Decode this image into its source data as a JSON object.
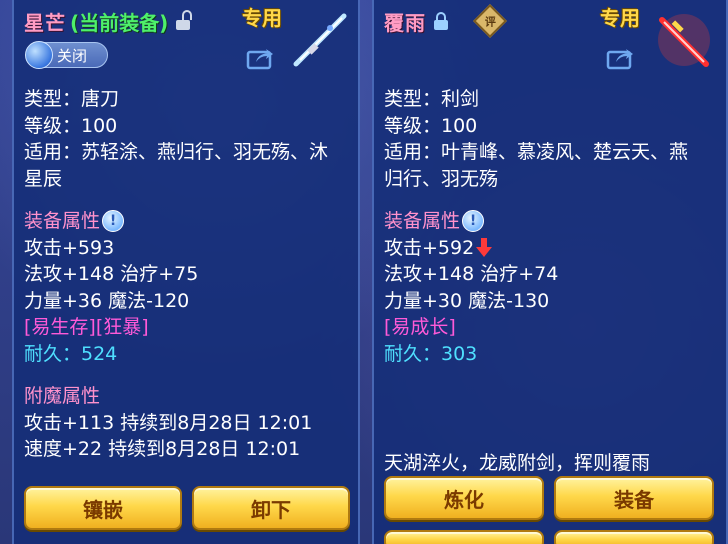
{
  "left": {
    "name": "星芒",
    "status": "(当前装备)",
    "badge": "专用",
    "toggle_label": "关闭",
    "type": "类型：唐刀",
    "level": "等级：100",
    "applicable_1": "适用：苏轻涂、燕归行、羽无殇、沐",
    "applicable_2": "星辰",
    "attr_title": "装备属性",
    "attack": "攻击+593",
    "magic_heal": "法攻+148 治疗+75",
    "str_magic": "力量+36 魔法-120",
    "special": "[易生存][狂暴]",
    "durability": "耐久：524",
    "enchant_title": "附魔属性",
    "enchant_1": "攻击+113 持续到8月28日 12:01",
    "enchant_2": "速度+22 持续到8月28日 12:01",
    "btn_inlay": "镶嵌",
    "btn_unequip": "卸下"
  },
  "right": {
    "name": "覆雨",
    "rate_badge": "评",
    "badge": "专用",
    "type": "类型：利剑",
    "level": "等级：100",
    "applicable_1": "适用：叶青峰、慕凌风、楚云天、燕",
    "applicable_2": "归行、羽无殇",
    "attr_title": "装备属性",
    "attack": "攻击+592",
    "magic_heal": "法攻+148 治疗+74",
    "str_magic": "力量+30 魔法-130",
    "special": "[易成长]",
    "durability": "耐久：303",
    "description": "天湖淬火，龙威附剑，挥则覆雨",
    "btn_refine": "炼化",
    "btn_equip": "装备"
  },
  "colors": {
    "panel_bg": "#142d78",
    "title_pink": "#ff9cc4",
    "title_green": "#4ef06a",
    "section_pink": "#ff92cc",
    "special_magenta": "#ff5ad8",
    "durability_cyan": "#4fe0ff",
    "button_gold": "#ffd84a",
    "badge_yellow": "#ffd84a"
  }
}
